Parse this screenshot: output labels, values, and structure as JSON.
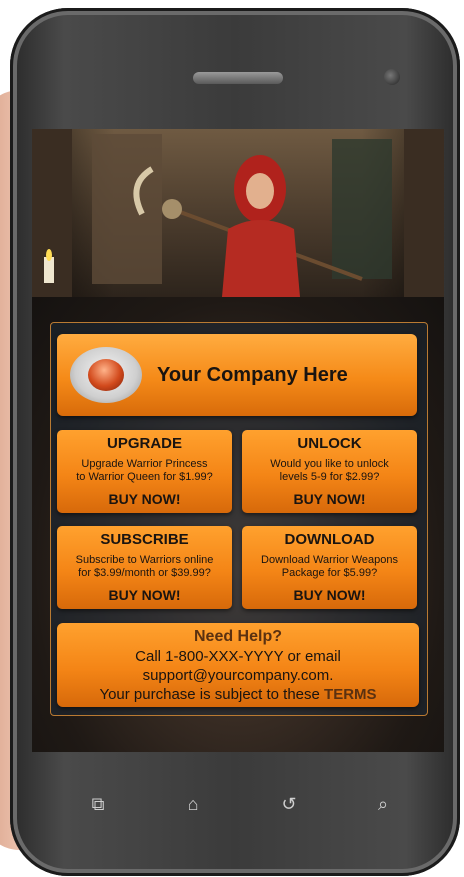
{
  "company": {
    "name": "Your Company Here"
  },
  "tiles": [
    {
      "title": "UPGRADE",
      "desc1": "Upgrade Warrior Princess",
      "desc2": "to Warrior Queen for $1.99?",
      "buy": "BUY NOW!"
    },
    {
      "title": "UNLOCK",
      "desc1": "Would you like to unlock",
      "desc2": "levels 5-9 for $2.99?",
      "buy": "BUY NOW!"
    },
    {
      "title": "SUBSCRIBE",
      "desc1": "Subscribe to Warriors online",
      "desc2": "for $3.99/month or $39.99?",
      "buy": "BUY NOW!"
    },
    {
      "title": "DOWNLOAD",
      "desc1": "Download Warrior Weapons",
      "desc2": "Package for $5.99?",
      "buy": "BUY NOW!"
    }
  ],
  "help": {
    "title": "Need Help?",
    "line1": "Call 1-800-XXX-YYYY or email",
    "line2": "support@yourcompany.com.",
    "line3_prefix": "Your purchase is subject to these ",
    "terms": "TERMS"
  },
  "nav": {
    "icons": [
      "recent-apps-icon",
      "home-icon",
      "back-icon",
      "search-icon"
    ]
  }
}
